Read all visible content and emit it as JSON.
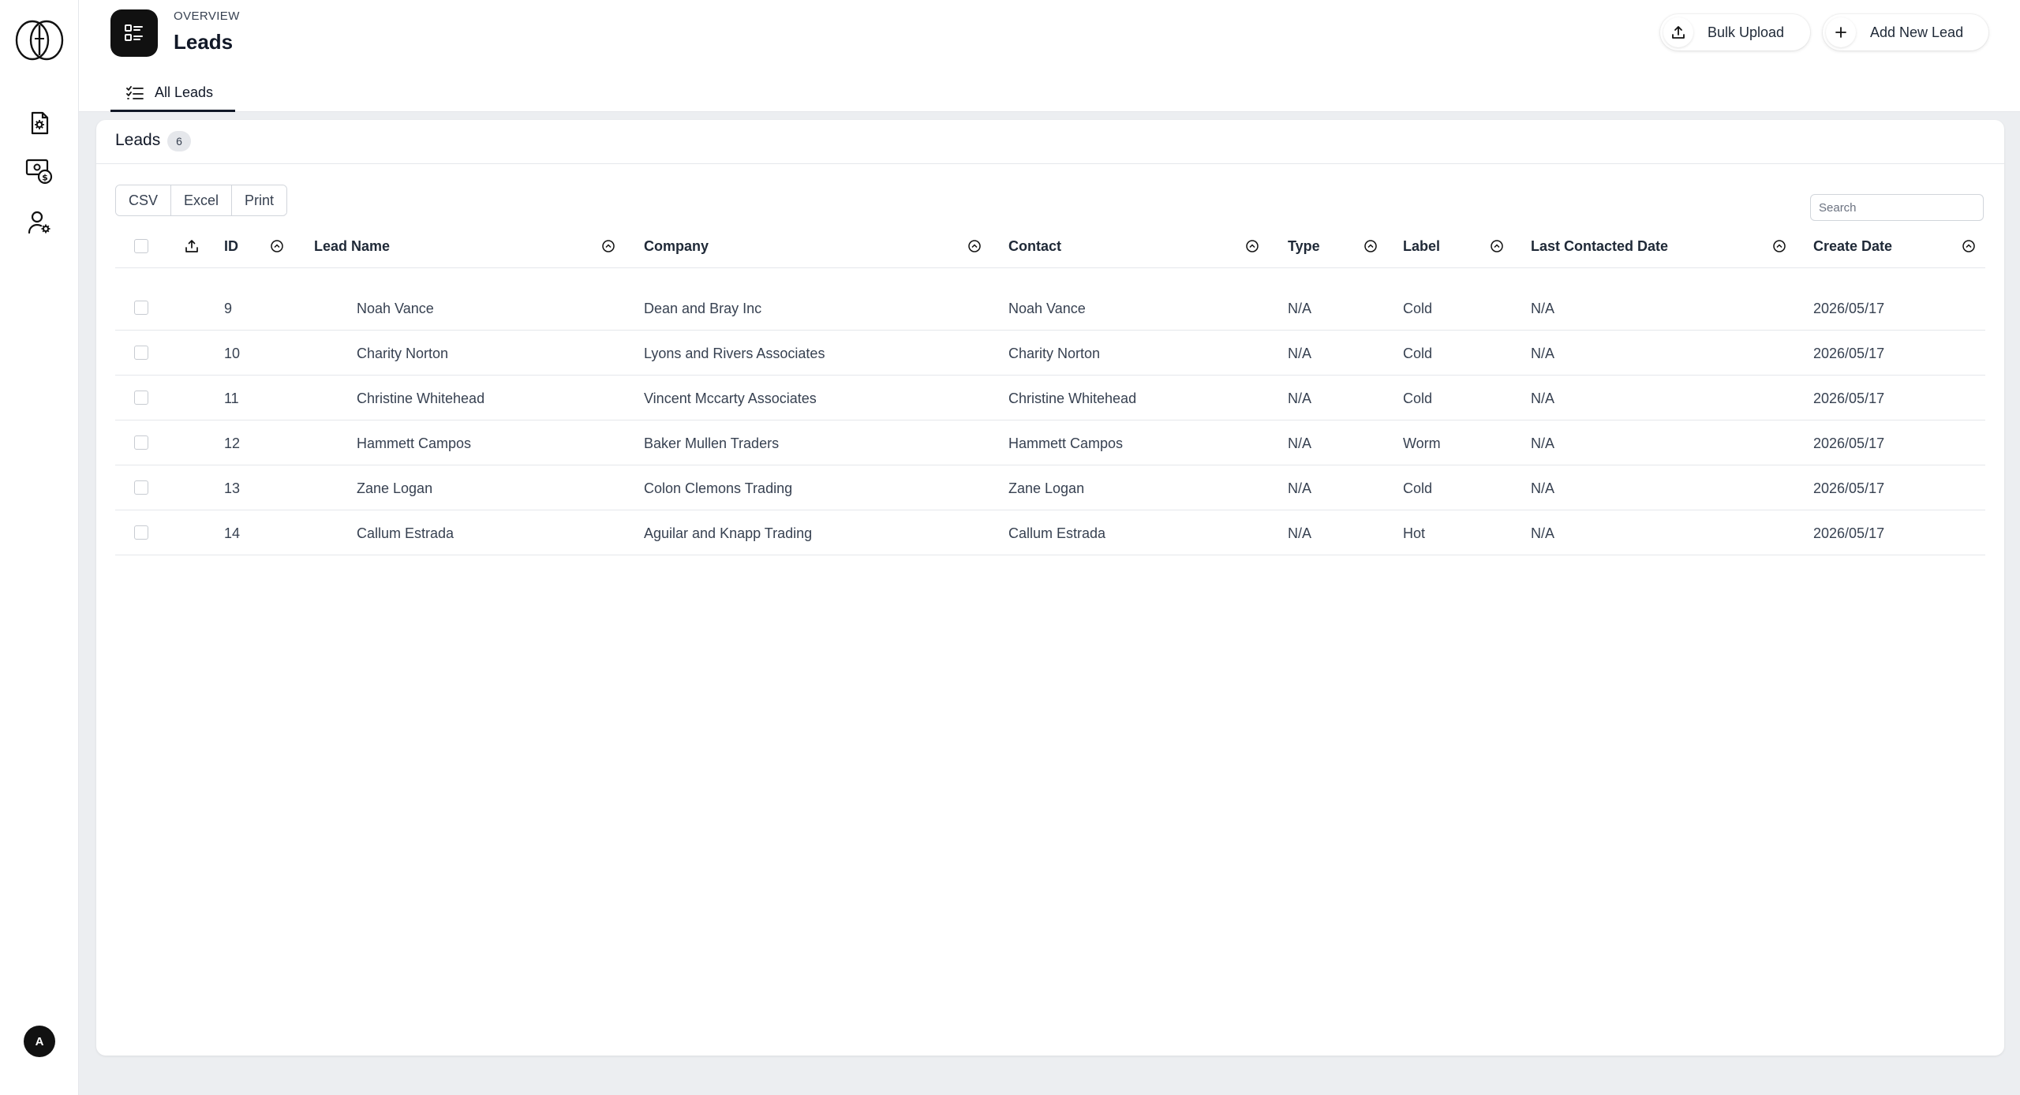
{
  "header": {
    "overline": "OVERVIEW",
    "title": "Leads",
    "tab": "All Leads",
    "bulk_upload_label": "Bulk Upload",
    "add_new_label": "Add New Lead"
  },
  "sidebar": {
    "items": [
      {
        "icon": "settings-document-icon"
      },
      {
        "icon": "money-icon"
      },
      {
        "icon": "user-settings-icon"
      }
    ],
    "avatar_initial": "A"
  },
  "card": {
    "title": "Leads",
    "count": "6",
    "export_buttons": [
      "CSV",
      "Excel",
      "Print"
    ],
    "search_placeholder": "Search"
  },
  "table": {
    "columns": [
      "ID",
      "Lead Name",
      "Company",
      "Contact",
      "Type",
      "Label",
      "Last Contacted Date",
      "Create Date"
    ],
    "rows": [
      {
        "id": "9",
        "lead_name": "Noah Vance",
        "company": "Dean and Bray Inc",
        "contact": "Noah Vance",
        "type": "N/A",
        "label": "Cold",
        "last_contacted": "N/A",
        "create_date": "2026/05/17"
      },
      {
        "id": "10",
        "lead_name": "Charity Norton",
        "company": "Lyons and Rivers Associates",
        "contact": "Charity Norton",
        "type": "N/A",
        "label": "Cold",
        "last_contacted": "N/A",
        "create_date": "2026/05/17"
      },
      {
        "id": "11",
        "lead_name": "Christine Whitehead",
        "company": "Vincent Mccarty Associates",
        "contact": "Christine Whitehead",
        "type": "N/A",
        "label": "Cold",
        "last_contacted": "N/A",
        "create_date": "2026/05/17"
      },
      {
        "id": "12",
        "lead_name": "Hammett Campos",
        "company": "Baker Mullen Traders",
        "contact": "Hammett Campos",
        "type": "N/A",
        "label": "Worm",
        "last_contacted": "N/A",
        "create_date": "2026/05/17"
      },
      {
        "id": "13",
        "lead_name": "Zane Logan",
        "company": "Colon Clemons Trading",
        "contact": "Zane Logan",
        "type": "N/A",
        "label": "Cold",
        "last_contacted": "N/A",
        "create_date": "2026/05/17"
      },
      {
        "id": "14",
        "lead_name": "Callum Estrada",
        "company": "Aguilar and Knapp Trading",
        "contact": "Callum Estrada",
        "type": "N/A",
        "label": "Hot",
        "last_contacted": "N/A",
        "create_date": "2026/05/17"
      }
    ]
  }
}
